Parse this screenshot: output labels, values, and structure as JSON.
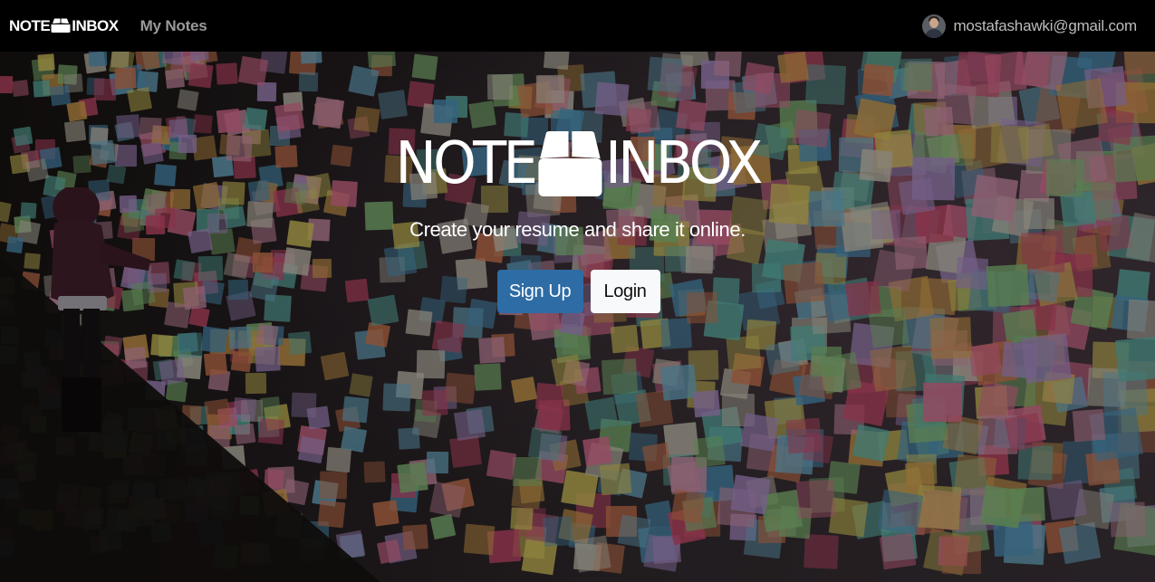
{
  "navbar": {
    "brand_left": "NOTE",
    "brand_right": "INBOX",
    "brand_icon": "inbox-box-icon",
    "my_notes_label": "My Notes",
    "user_email": "mostafashawki@gmail.com",
    "avatar_icon": "user-avatar"
  },
  "hero": {
    "logo_left": "NOTE",
    "logo_right": "INBOX",
    "logo_icon": "inbox-box-icon",
    "tagline": "Create your resume and share it online.",
    "signup_label": "Sign Up",
    "login_label": "Login",
    "background": "sticky-notes-wall-photo"
  },
  "colors": {
    "navbar_bg": "#000000",
    "signup_bg": "#2e6ca5",
    "login_bg": "#f8f9fa",
    "nav_link": "#9a9a9a"
  }
}
